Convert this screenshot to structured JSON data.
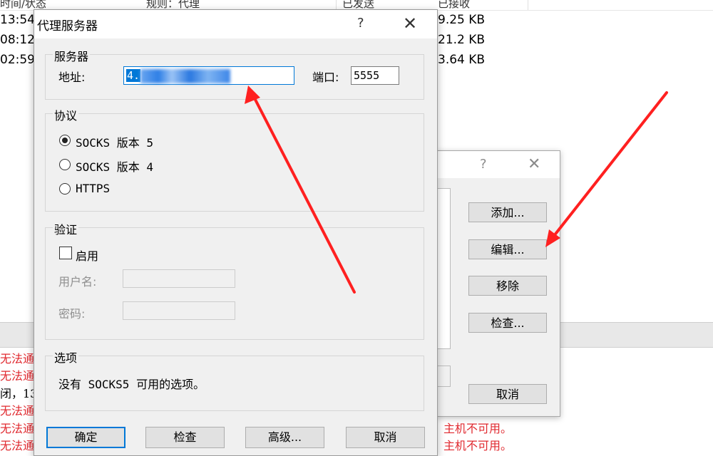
{
  "background": {
    "columns": [
      "时间/状态",
      "规则：代理",
      "已发送",
      "已接收"
    ],
    "rows": [
      {
        "time": "13:54",
        "received": "9.25 KB"
      },
      {
        "time": "08:12",
        "received": "21.2 KB"
      },
      {
        "time": "02:59",
        "received": "3.64 KB"
      }
    ],
    "log": {
      "left": [
        "无法通",
        "无法通",
        "闭，13",
        "无法通",
        "无法通",
        "无法通"
      ],
      "right": [
        "主机不可用。",
        "主机不可用。"
      ]
    }
  },
  "secondary_dialog": {
    "help": "?",
    "close": "✕",
    "buttons": {
      "add": "添加...",
      "edit": "编辑...",
      "remove": "移除",
      "check": "检查...",
      "cancel": "取消"
    }
  },
  "dialog": {
    "title": "代理服务器",
    "help": "?",
    "close": "✕",
    "server": {
      "group_label": "服务器",
      "address_label": "地址:",
      "address_value": "4.",
      "port_label": "端口:",
      "port_value": "5555"
    },
    "protocol": {
      "group_label": "协议",
      "options": [
        "SOCKS 版本 5",
        "SOCKS 版本 4",
        "HTTPS"
      ],
      "selected": "SOCKS 版本 5"
    },
    "auth": {
      "group_label": "验证",
      "enable_label": "启用",
      "enabled": false,
      "username_label": "用户名:",
      "password_label": "密码:"
    },
    "options": {
      "group_label": "选项",
      "text": "没有 SOCKS5 可用的选项。"
    },
    "buttons": {
      "ok": "确定",
      "check": "检查",
      "advanced": "高级...",
      "cancel": "取消"
    }
  },
  "annotation_color": "#ff2020"
}
